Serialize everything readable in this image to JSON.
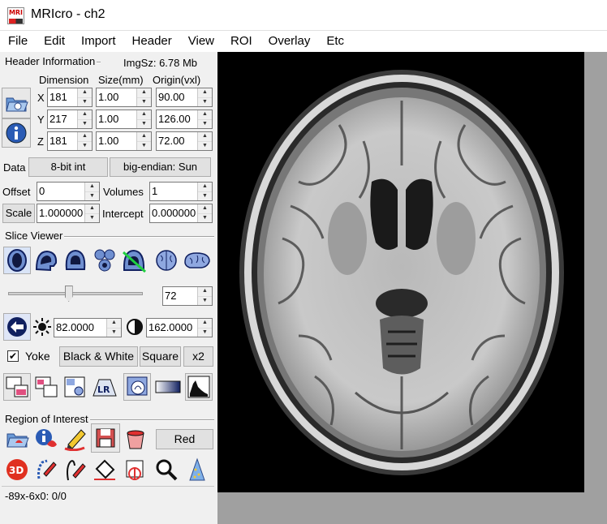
{
  "window": {
    "title": "MRIcro - ch2",
    "icon_text": "MRI"
  },
  "menu": [
    "File",
    "Edit",
    "Import",
    "Header",
    "View",
    "ROI",
    "Overlay",
    "Etc"
  ],
  "header_info": {
    "group_title": "Header Information",
    "img_size": "ImgSz: 6.78 Mb",
    "col_dimension": "Dimension",
    "col_size": "Size(mm)",
    "col_origin": "Origin(vxl)",
    "rows": [
      {
        "axis": "X",
        "dimension": "181",
        "size": "1.00",
        "origin": "90.00"
      },
      {
        "axis": "Y",
        "dimension": "217",
        "size": "1.00",
        "origin": "126.00"
      },
      {
        "axis": "Z",
        "dimension": "181",
        "size": "1.00",
        "origin": "72.00"
      }
    ],
    "data_label": "Data",
    "data_type": "8-bit int",
    "endian": "big-endian: Sun",
    "offset_label": "Offset",
    "offset_value": "0",
    "volumes_label": "Volumes",
    "volumes_value": "1",
    "scale_label": "Scale",
    "scale_value": "1.000000",
    "intercept_label": "Intercept",
    "intercept_value": "0.000000"
  },
  "slice_viewer": {
    "group_title": "Slice Viewer",
    "slice_value": "72",
    "slider_fraction": 0.45,
    "brightness": "82.0000",
    "contrast": "162.0000",
    "yoke_label": "Yoke",
    "yoke_checked": true,
    "bw_button": "Black & White",
    "square_button": "Square",
    "zoom_button": "x2"
  },
  "roi": {
    "group_title": "Region of Interest",
    "color_button": "Red"
  },
  "status": {
    "text": "-89x-6x0: 0/0"
  }
}
